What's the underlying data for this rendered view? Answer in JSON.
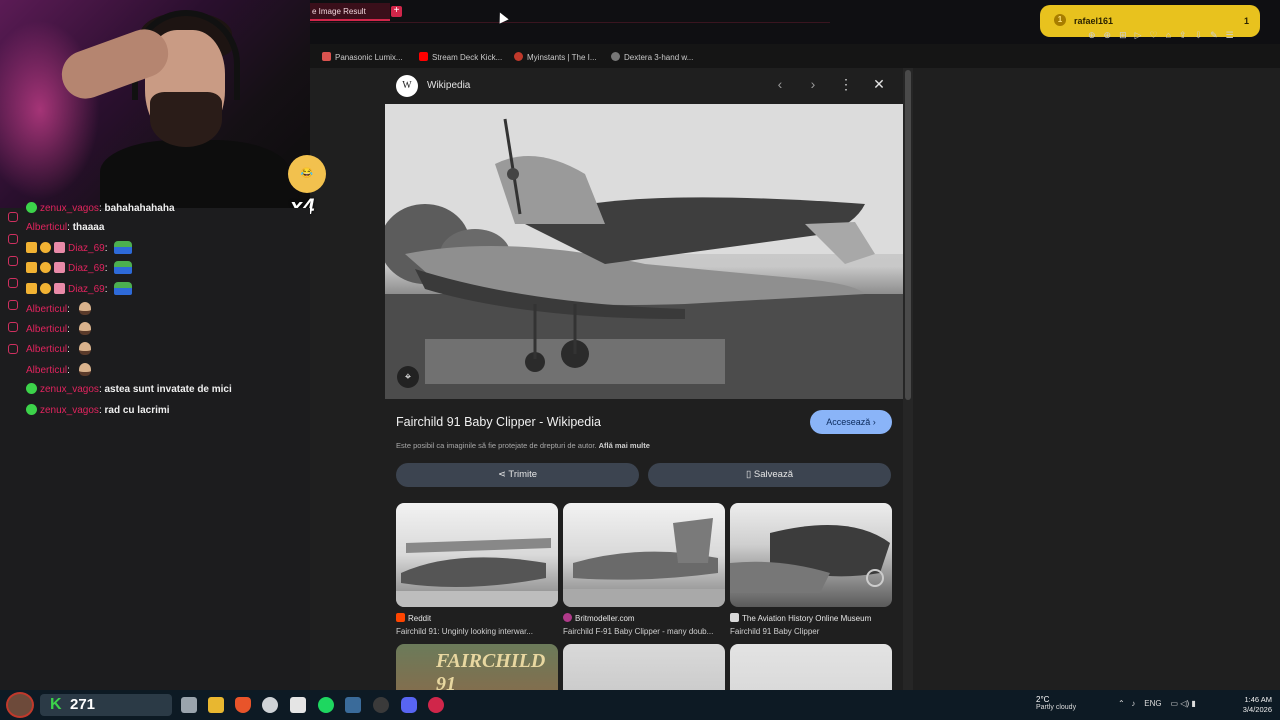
{
  "browser": {
    "active_tab": "e Image Result",
    "bookmarks": [
      "Panasonic Lumix...",
      "Stream Deck Kick...",
      "Myinstants | The I...",
      "Dextera 3-hand w..."
    ]
  },
  "twitch_popup": {
    "user": "rafael161",
    "count": "1"
  },
  "webcam": {
    "emote_multiplier": "x4"
  },
  "chat": {
    "messages": [
      {
        "user": "zenux_vagos",
        "text": "bahahahahaha",
        "color": "#e0245e"
      },
      {
        "user": "Alberticul",
        "text": "thaaaa",
        "color": "#e0245e"
      },
      {
        "user": "Diaz_69",
        "text": "",
        "color": "#e0245e"
      },
      {
        "user": "Diaz_69",
        "text": "",
        "color": "#e0245e"
      },
      {
        "user": "Diaz_69",
        "text": "",
        "color": "#e0245e"
      },
      {
        "user": "Alberticul",
        "text": "",
        "color": "#e0245e"
      },
      {
        "user": "Alberticul",
        "text": "",
        "color": "#e0245e"
      },
      {
        "user": "Alberticul",
        "text": "",
        "color": "#e0245e"
      },
      {
        "user": "Alberticul",
        "text": "",
        "color": "#e0245e"
      },
      {
        "user": "zenux_vagos",
        "text": "astea sunt invatate de mici",
        "color": "#e0245e"
      },
      {
        "user": "zenux_vagos",
        "text": "rad cu lacrimi",
        "color": "#e0245e"
      }
    ]
  },
  "modal": {
    "source_name": "Wikipedia",
    "source_logo": "W",
    "title": "Fairchild 91 Baby Clipper - Wikipedia",
    "visit_label": "Accesează",
    "copyright": "Este posibil ca imaginile să fie protejate de drepturi de autor.",
    "copyright_link": "Află mai multe",
    "share_label": "Trimite",
    "save_label": "Salvează",
    "related": [
      {
        "site": "Reddit",
        "caption": "Fairchild 91: Unginly looking interwar..."
      },
      {
        "site": "Britmodeller.com",
        "caption": "Fairchild F-91 Baby Clipper - many doub..."
      },
      {
        "site": "The Aviation History Online Museum",
        "caption": "Fairchild 91 Baby Clipper"
      }
    ],
    "bottom_thumb_text": "FAIRCHILD 91"
  },
  "taskbar": {
    "points": "271",
    "points_prefix": "K",
    "weather_temp": "2°C",
    "weather_desc": "Partly cloudy",
    "lang": "ENG",
    "time": "1:46 AM",
    "date": "3/4/2026"
  },
  "colors": {
    "accent_red": "#d0264a",
    "visit_button": "#8ab4f8",
    "twitch_gold": "#e8c21e"
  }
}
